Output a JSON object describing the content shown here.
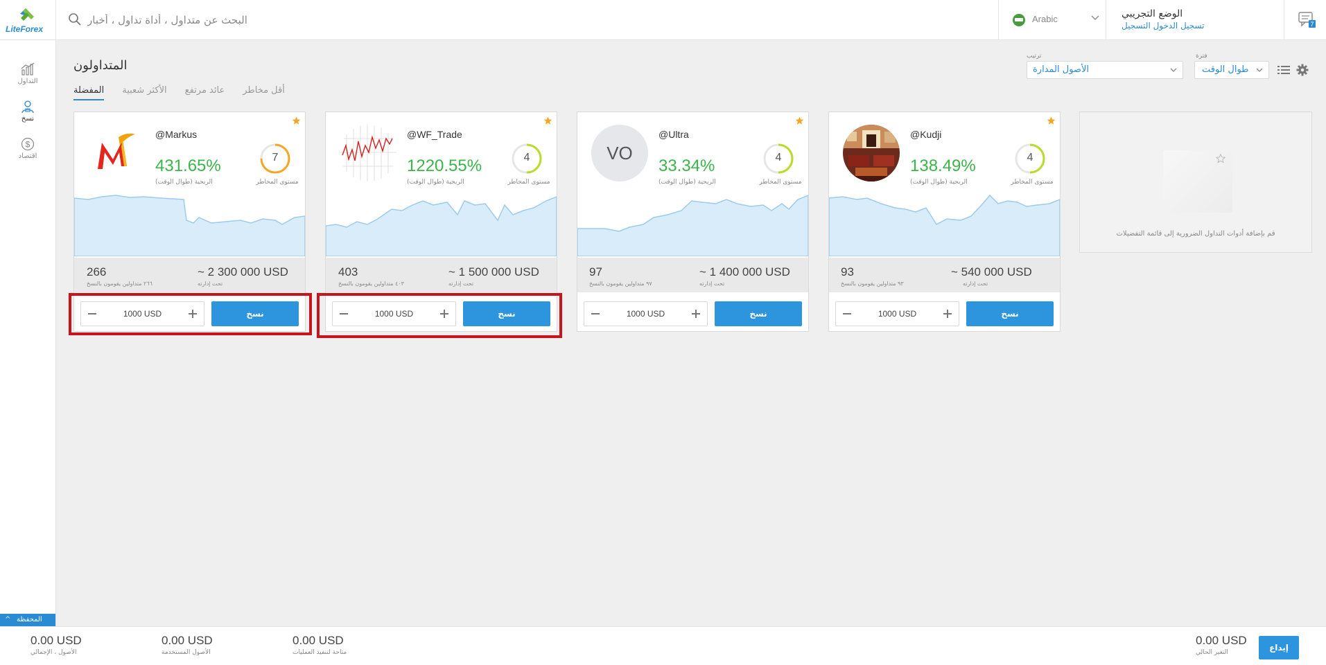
{
  "header": {
    "logo_text": "LiteForex",
    "search_placeholder": "البحث عن متداول ، أداة تداول ، أخبار",
    "language": "Arabic",
    "mode_title": "الوضع التجريبي",
    "register_link": "تسجيل الدخول التسجيل",
    "messages_count": "7"
  },
  "sidebar": {
    "items": [
      {
        "label": "التداول",
        "icon": "chart-icon"
      },
      {
        "label": "نسخ",
        "icon": "user-copy-icon"
      },
      {
        "label": "اقتصاد",
        "icon": "dollar-icon"
      }
    ],
    "wallet_label": "المحفظة"
  },
  "page": {
    "title": "المتداولون",
    "tabs": [
      "المفضلة",
      "الأكثر شعبية",
      "عائد مرتفع",
      "أقل مخاطر"
    ],
    "sort_caption": "ترتيب",
    "sort_value": "الأصول المدارة",
    "period_caption": "فترة",
    "period_value": "طوال الوقت"
  },
  "traders": [
    {
      "handle": "@Markus",
      "profit": "431.65%",
      "profit_label": "الربحية (طوال الوقت)",
      "risk": "7",
      "risk_fraction": 0.75,
      "risk_color": "#f5a623",
      "risk_label": "مستوى المخاطر",
      "managed": "~ 2 300 000 USD",
      "managed_label": "تحت إدارته",
      "copiers": "266",
      "copiers_label": "٢٦٦ متداولين يقومون بالنسخ",
      "amount": "1000 USD",
      "copy_label": "نسخ",
      "favorite": true
    },
    {
      "handle": "@WF_Trade",
      "profit": "1220.55%",
      "profit_label": "الربحية (طوال الوقت)",
      "risk": "4",
      "risk_fraction": 0.5,
      "risk_color": "#b8dc2a",
      "risk_label": "مستوى المخاطر",
      "managed": "~ 1 500 000 USD",
      "managed_label": "تحت إدارته",
      "copiers": "403",
      "copiers_label": "٤٠٣ متداولين يقومون بالنسخ",
      "amount": "1000 USD",
      "copy_label": "نسخ",
      "favorite": true
    },
    {
      "handle": "@Ultra",
      "profit": "33.34%",
      "profit_label": "الربحية (طوال الوقت)",
      "risk": "4",
      "risk_fraction": 0.5,
      "risk_color": "#b8dc2a",
      "risk_label": "مستوى المخاطر",
      "managed": "~ 1 400 000 USD",
      "managed_label": "تحت إدارته",
      "copiers": "97",
      "copiers_label": "٩٧ متداولين يقومون بالنسخ",
      "amount": "1000 USD",
      "copy_label": "نسخ",
      "avatar_text": "VO",
      "favorite": true
    },
    {
      "handle": "@Kudji",
      "profit": "138.49%",
      "profit_label": "الربحية (طوال الوقت)",
      "risk": "4",
      "risk_fraction": 0.5,
      "risk_color": "#b8dc2a",
      "risk_label": "مستوى المخاطر",
      "managed": "~ 540 000 USD",
      "managed_label": "تحت إدارته",
      "copiers": "93",
      "copiers_label": "٩٣ متداولين يقومون بالنسخ",
      "amount": "1000 USD",
      "copy_label": "نسخ",
      "favorite": true
    }
  ],
  "placeholder_text": "قم بإضافة أدوات التداول الضرورية إلى قائمة التفضيلات",
  "footer": {
    "stats": [
      {
        "value": "0.00 USD",
        "label": "الأصول ، الإجمالي"
      },
      {
        "value": "0.00 USD",
        "label": "الأصول المستخدمة"
      },
      {
        "value": "0.00 USD",
        "label": "متاحة لتنفيذ العمليات"
      }
    ],
    "change_value": "0.00 USD",
    "change_label": "التغير الحالي",
    "deposit_label": "إيداع"
  },
  "colors": {
    "accent": "#2d95dd",
    "profit": "#3bb54a",
    "highlight": "#c8141a"
  }
}
